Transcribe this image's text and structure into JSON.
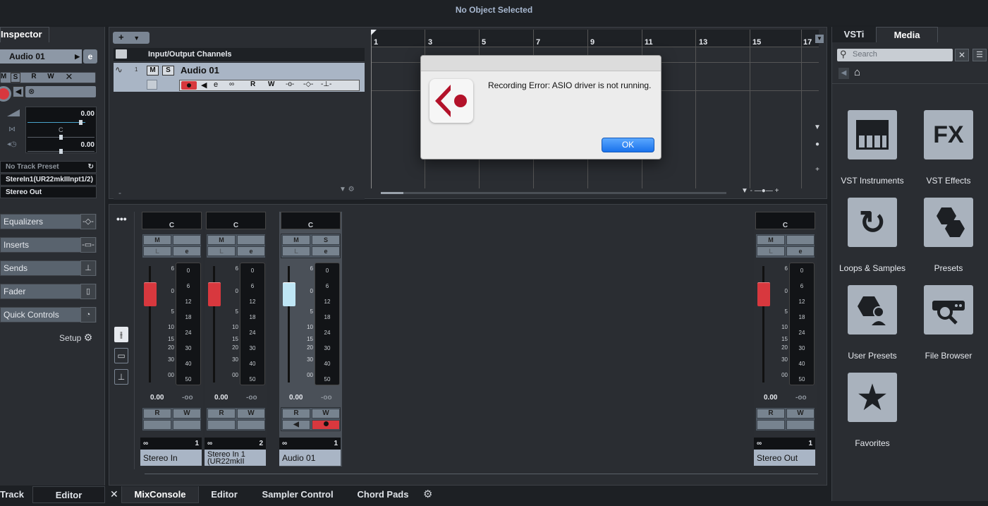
{
  "app": {
    "title": "No Object Selected"
  },
  "inspector": {
    "title": "Inspector",
    "track_name": "Audio 01",
    "volume": "0.00",
    "pan": "C",
    "delay": "0.00",
    "track_preset": "No Track Preset",
    "input": "StereIn1(UR22mkIIInpt1/2)",
    "output": "Stereo Out",
    "sections": [
      "Equalizers",
      "Inserts",
      "Sends",
      "Fader",
      "Quick Controls"
    ],
    "setup_label": "Setup",
    "bottom_tabs": [
      "Track",
      "Editor"
    ]
  },
  "project": {
    "folder_label": "Input/Output Channels",
    "track_number": "1",
    "track_name": "Audio 01",
    "ruler": [
      "1",
      "3",
      "5",
      "7",
      "9",
      "11",
      "13",
      "15",
      "17"
    ]
  },
  "dialog": {
    "message": "Recording Error: ASIO driver is not running.",
    "ok_label": "OK"
  },
  "mixer": {
    "channels": [
      {
        "name": "Stereo In",
        "number": "1",
        "pan": "C",
        "volume": "0.00",
        "peak": "-oo",
        "selected": false
      },
      {
        "name": "Stereo In 1 (UR22mkII",
        "number": "2",
        "pan": "C",
        "volume": "0.00",
        "peak": "-oo",
        "selected": false
      },
      {
        "name": "Audio 01",
        "number": "1",
        "pan": "C",
        "volume": "0.00",
        "peak": "-oo",
        "selected": true
      },
      {
        "name": "Stereo Out",
        "number": "1",
        "pan": "C",
        "volume": "0.00",
        "peak": "-oo",
        "selected": false
      }
    ],
    "fader_scale": [
      "6",
      "0",
      "5",
      "10",
      "15",
      "20",
      "30",
      "00"
    ],
    "meter_scale": [
      "0",
      "6",
      "12",
      "18",
      "24",
      "30",
      "40",
      "50"
    ],
    "btn_m": "M",
    "btn_s": "S",
    "btn_l": "L",
    "btn_e": "e",
    "btn_r": "R",
    "btn_w": "W",
    "bottom_tabs": [
      "MixConsole",
      "Editor",
      "Sampler Control",
      "Chord Pads"
    ]
  },
  "media": {
    "tabs": [
      "VSTi",
      "Media"
    ],
    "search_placeholder": "Search",
    "items": [
      {
        "label": "VST Instruments",
        "icon": "piano-keys-icon"
      },
      {
        "label": "VST Effects",
        "icon": "fx-icon"
      },
      {
        "label": "Loops & Samples",
        "icon": "loop-icon"
      },
      {
        "label": "Presets",
        "icon": "hexagons-icon"
      },
      {
        "label": "User Presets",
        "icon": "user-hex-icon"
      },
      {
        "label": "File Browser",
        "icon": "search-folder-icon"
      },
      {
        "label": "Favorites",
        "icon": "star-icon"
      }
    ]
  },
  "colors": {
    "record": "#d8383e",
    "selected_fader": "#bfe6f5",
    "red_fader": "#d8383e",
    "ok_button": "#1f7cf0"
  }
}
